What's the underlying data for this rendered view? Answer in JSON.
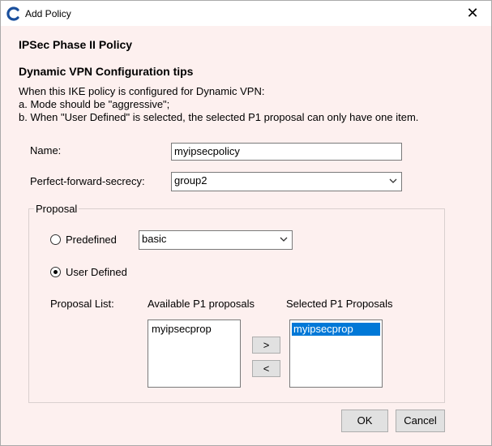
{
  "window": {
    "title": "Add Policy",
    "close_glyph": "✕"
  },
  "header": {
    "heading": "IPSec Phase II Policy",
    "tips_title": "Dynamic VPN Configuration tips",
    "tips_lines": [
      "When this IKE policy is configured for Dynamic VPN:",
      "a. Mode should be \"aggressive\";",
      "b. When \"User Defined\" is selected, the selected P1 proposal can  only have one item."
    ]
  },
  "form": {
    "name_label": "Name:",
    "name_value": "myipsecpolicy",
    "pfs_label": "Perfect-forward-secrecy:",
    "pfs_value": "group2"
  },
  "proposal": {
    "legend": "Proposal",
    "predefined_label": "Predefined",
    "predefined_value": "basic",
    "predefined_checked": false,
    "user_defined_label": "User Defined",
    "user_defined_checked": true,
    "list_label": "Proposal List:",
    "available_title": "Available P1 proposals",
    "selected_title": "Selected P1 Proposals",
    "available_items": [
      "myipsecprop"
    ],
    "selected_items": [
      "myipsecprop"
    ],
    "add_label": ">",
    "remove_label": "<"
  },
  "buttons": {
    "ok": "OK",
    "cancel": "Cancel"
  },
  "colors": {
    "dialog_bg": "#fdf0ef",
    "selection": "#0078d7",
    "icon_blue": "#1a4f9c"
  }
}
